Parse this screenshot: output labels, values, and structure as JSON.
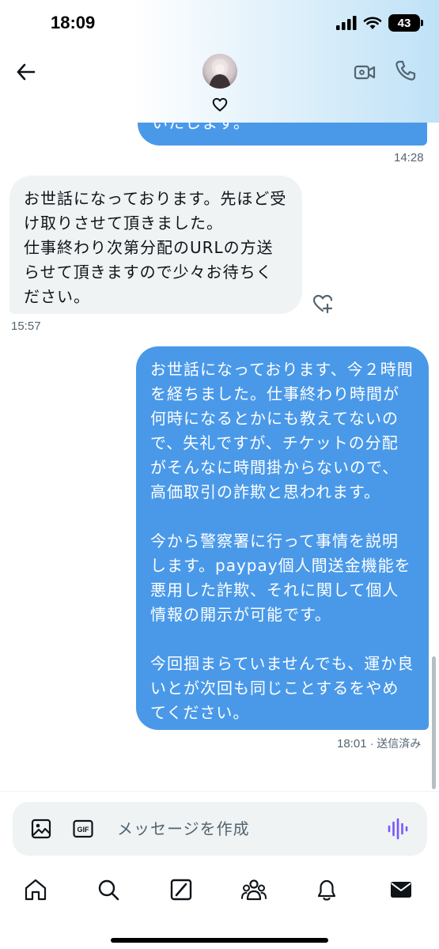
{
  "status_bar": {
    "time": "18:09",
    "battery": "43",
    "signal_icon": "signal-bars-icon",
    "wifi_icon": "wifi-icon"
  },
  "header": {
    "back_icon": "arrow-left-icon",
    "avatar_icon": "avatar",
    "badge_icon": "heart-icon",
    "video_icon": "video-call-icon",
    "phone_icon": "phone-call-icon"
  },
  "messages": [
    {
      "direction": "outgoing",
      "lines": [
        "いたします。"
      ],
      "timestamp": "14:28"
    },
    {
      "direction": "incoming",
      "lines": [
        "お世話になっております。先ほど受け取りさせて頂きました。",
        "仕事終わり次第分配のURLの方送らせて頂きますので少々お待ちください。"
      ],
      "timestamp": "15:57"
    },
    {
      "direction": "outgoing",
      "paragraphs": [
        "お世話になっております、今２時間を経ちました。仕事終わり時間が何時になるとかにも教えてないので、失礼ですが、チケットの分配がそんなに時間掛からないので、高価取引の詐欺と思われます。",
        "今から警察署に行って事情を説明します。paypay個人間送金機能を悪用した詐欺、それに関して個人情報の開示が可能です。",
        "今回掴まらていませんでも、運か良いとが次回も同じことするをやめてください。"
      ],
      "timestamp": "18:01",
      "status": "· 送信済み"
    }
  ],
  "composer": {
    "placeholder": "メッセージを作成",
    "image_icon": "image-icon",
    "gif_icon": "gif-icon",
    "gif_label": "GIF",
    "voice_icon": "voice-wave-icon",
    "accent_color": "#7856ff"
  },
  "bottom_nav": {
    "items": [
      "home-icon",
      "search-icon",
      "grok-icon",
      "communities-icon",
      "notifications-icon",
      "messages-icon"
    ],
    "active": "messages-icon"
  },
  "colors": {
    "outgoing_bubble": "#4a99e9",
    "incoming_bubble": "#eff3f4",
    "timestamp": "#536471"
  }
}
